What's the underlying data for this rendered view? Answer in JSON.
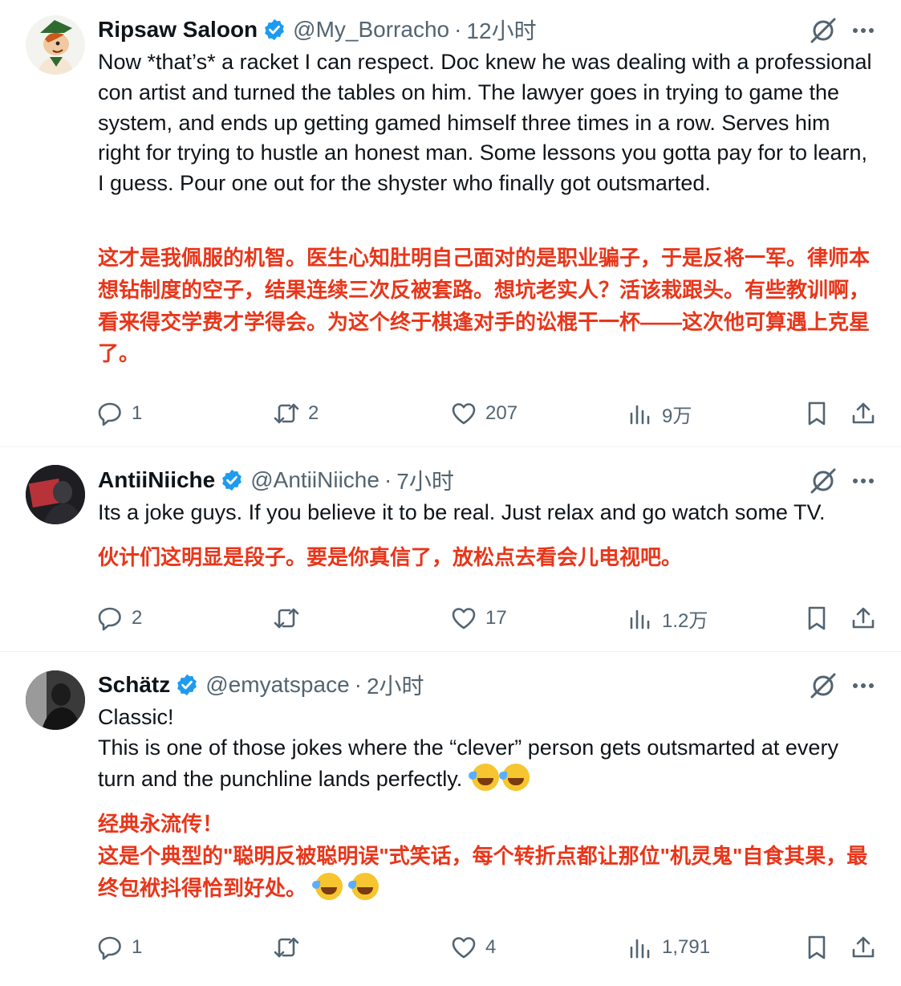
{
  "tweets": [
    {
      "name": "Ripsaw Saloon",
      "handle": "@My_Borracho",
      "separator": "·",
      "time": "12小时",
      "text_en": "Now *that’s* a racket I can respect. Doc knew he was dealing with a professional con artist and turned the tables on him. The lawyer goes in trying to game the system, and ends up getting gamed himself three times in a row. Serves him right for trying to hustle an honest man. Some lessons you gotta pay for to learn, I guess. Pour one out for the shyster who finally got outsmarted.",
      "text_zh": "这才是我佩服的机智。医生心知肚明自己面对的是职业骗子，于是反将一军。律师本想钻制度的空子，结果连续三次反被套路。想坑老实人？活该栽跟头。有些教训啊，看来得交学费才学得会。为这个终于棋逢对手的讼棍干一杯——这次他可算遇上克星了。",
      "replies": "1",
      "retweets": "2",
      "likes": "207",
      "views": "9万"
    },
    {
      "name": "AntiiNiiche",
      "handle": "@AntiiNiiche",
      "separator": "·",
      "time": "7小时",
      "text_en": "Its a joke guys. If you believe it to be real. Just relax and go watch some TV.",
      "text_zh": "伙计们这明显是段子。要是你真信了，放松点去看会儿电视吧。",
      "replies": "2",
      "retweets": "",
      "likes": "17",
      "views": "1.2万"
    },
    {
      "name": "Schätz",
      "handle": "@emyatspace",
      "separator": "·",
      "time": "2小时",
      "text_en_line1": "Classic!",
      "text_en_line2": "This is one of those jokes where the “clever” person gets outsmarted at every turn and the punchline lands perfectly.",
      "text_zh_line1": "经典永流传！",
      "text_zh_line2": "这是个典型的\"聪明反被聪明误\"式笑话，每个转折点都让那位\"机灵鬼\"自食其果，最终包袱抖得恰到好处。",
      "emoji": "rolling-on-floor-laughing",
      "replies": "1",
      "retweets": "",
      "likes": "4",
      "views": "1,791"
    }
  ],
  "colors": {
    "text": "#0f1419",
    "secondary": "#536471",
    "translation": "#e8361a",
    "verified": "#1d9bf0",
    "divider": "#eff3f4"
  }
}
